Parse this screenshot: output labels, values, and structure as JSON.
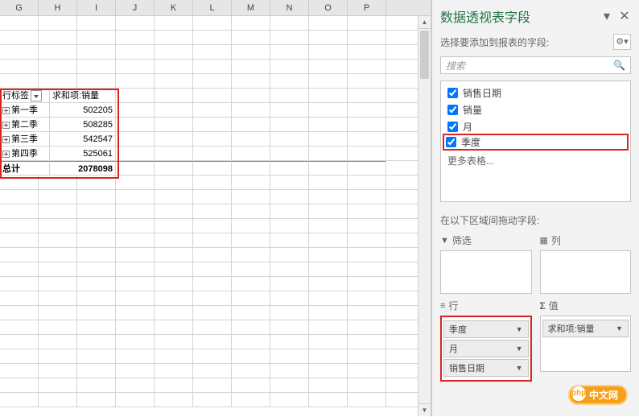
{
  "columns": [
    "G",
    "H",
    "I",
    "J",
    "K",
    "L",
    "M",
    "N",
    "O",
    "P"
  ],
  "pivot": {
    "row_label_header": "行标签",
    "value_header": "求和项:销量",
    "rows": [
      {
        "label": "第一季",
        "value": "502205"
      },
      {
        "label": "第二季",
        "value": "508285"
      },
      {
        "label": "第三季",
        "value": "542547"
      },
      {
        "label": "第四季",
        "value": "525061"
      }
    ],
    "total_label": "总计",
    "total_value": "2078098"
  },
  "pane": {
    "title": "数据透视表字段",
    "subtitle": "选择要添加到报表的字段:",
    "search_placeholder": "搜索",
    "fields": [
      {
        "label": "销售日期",
        "checked": true
      },
      {
        "label": "销量",
        "checked": true
      },
      {
        "label": "月",
        "checked": true
      },
      {
        "label": "季度",
        "checked": true,
        "highlight": true
      }
    ],
    "more_tables": "更多表格...",
    "drag_label": "在以下区域间拖动字段:",
    "areas": {
      "filter": {
        "title": "筛选",
        "items": []
      },
      "columns": {
        "title": "列",
        "items": []
      },
      "rows": {
        "title": "行",
        "items": [
          "季度",
          "月",
          "销售日期"
        ]
      },
      "values": {
        "title": "值",
        "items": [
          "求和项:销量"
        ]
      }
    }
  },
  "watermark": "中文网"
}
